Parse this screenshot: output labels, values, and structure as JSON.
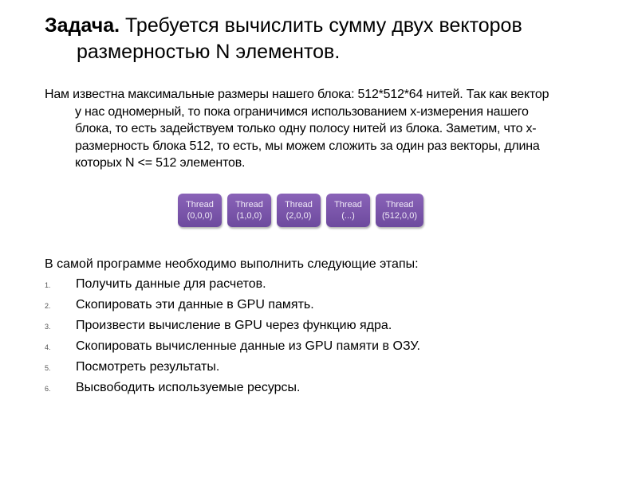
{
  "title": {
    "lead": "Задача.",
    "text": "Требуется вычислить сумму двух векторов",
    "continuation": "размерностью N элементов."
  },
  "intro": {
    "lines": [
      "Нам известна максимальные размеры нашего блока: 512*512*64 нитей. Так как вектор",
      "у нас одномерный, то пока ограничимся использованием x-измерения нашего",
      "блока, то есть задействуем только одну полосу нитей из блока. Заметим, что x-",
      "размерность блока 512, то есть, мы можем сложить за один раз векторы, длина",
      "которых N <= 512 элементов."
    ]
  },
  "threads": [
    {
      "label": "Thread",
      "index": "(0,0,0)"
    },
    {
      "label": "Thread",
      "index": "(1,0,0)"
    },
    {
      "label": "Thread",
      "index": "(2,0,0)"
    },
    {
      "label": "Thread",
      "index": "(...)"
    },
    {
      "label": "Thread",
      "index": "(512,0,0)"
    }
  ],
  "steps": {
    "heading": "В самой программе необходимо выполнить следующие этапы:",
    "items": [
      {
        "num": "1.",
        "text": "Получить данные для расчетов."
      },
      {
        "num": "2.",
        "text": "Скопировать эти данные в GPU память."
      },
      {
        "num": "3.",
        "text": "Произвести вычисление в GPU через функцию ядра."
      },
      {
        "num": "4.",
        "text": "Скопировать вычисленные данные из GPU памяти в ОЗУ."
      },
      {
        "num": "5.",
        "text": "Посмотреть результаты."
      },
      {
        "num": "6.",
        "text": "Высвободить используемые ресурсы."
      }
    ]
  },
  "colors": {
    "thread_box": "#7a55aa",
    "thread_text": "#f1ebf8"
  }
}
